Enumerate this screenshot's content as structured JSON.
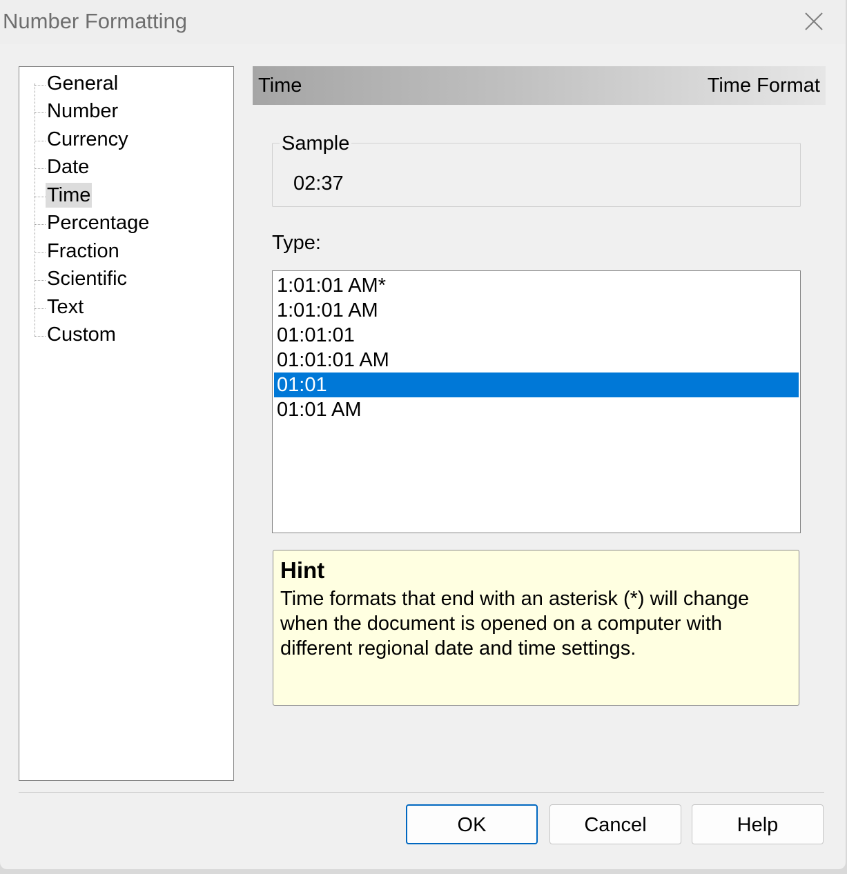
{
  "window": {
    "title": "Number Formatting"
  },
  "categories": [
    {
      "label": "General"
    },
    {
      "label": "Number"
    },
    {
      "label": "Currency"
    },
    {
      "label": "Date"
    },
    {
      "label": "Time"
    },
    {
      "label": "Percentage"
    },
    {
      "label": "Fraction"
    },
    {
      "label": "Scientific"
    },
    {
      "label": "Text"
    },
    {
      "label": "Custom"
    }
  ],
  "selected_category": "Time",
  "header": {
    "left": "Time",
    "right": "Time Format"
  },
  "sample": {
    "label": "Sample",
    "value": "02:37"
  },
  "type": {
    "label": "Type:",
    "items": [
      {
        "label": "1:01:01 AM*"
      },
      {
        "label": "1:01:01 AM"
      },
      {
        "label": "01:01:01"
      },
      {
        "label": "01:01:01 AM"
      },
      {
        "label": "01:01"
      },
      {
        "label": "01:01 AM"
      }
    ],
    "selected": "01:01"
  },
  "hint": {
    "title": "Hint",
    "text": "Time formats that end with an asterisk (*) will change when the document is opened on a computer with different regional date and time settings."
  },
  "buttons": {
    "ok": "OK",
    "cancel": "Cancel",
    "help": "Help"
  },
  "colors": {
    "selection": "#0078d7",
    "hint_background": "#ffffe1"
  }
}
